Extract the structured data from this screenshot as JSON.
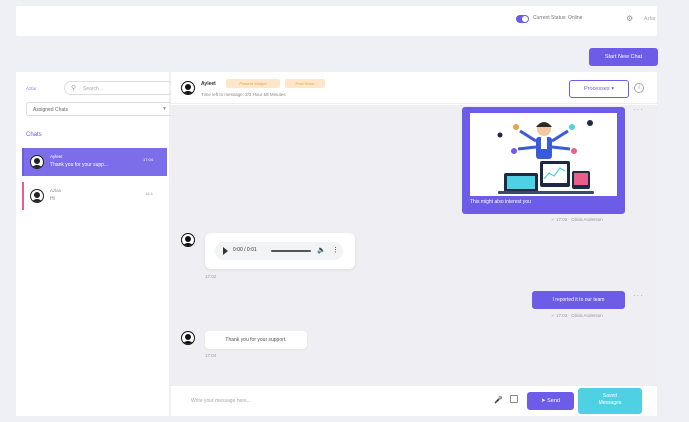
{
  "topbar": {
    "status_label": "Current Status: Online",
    "user_name": "Azfar"
  },
  "actions": {
    "start_new_chat": "Start New Chat"
  },
  "sidebar": {
    "filter_label": "Azfar",
    "search_placeholder": "Search...",
    "assigned_select": "Assigned Chats",
    "chats_heading": "Chats",
    "chats": [
      {
        "name": "Ayleet",
        "preview": "Thank you for your supp...",
        "time": "17:04",
        "active": true
      },
      {
        "name": "Azlan",
        "preview": "Hi",
        "time": "16:1",
        "active": false
      }
    ]
  },
  "conversation": {
    "contact_name": "Ayleet",
    "badges": [
      "Present Widget",
      "Pool Sessi"
    ],
    "subtitle": "Time left to message: 2/3 Hour 58 Minutes",
    "process_button": "Processes",
    "messages": [
      {
        "type": "image",
        "direction": "out",
        "caption": "This might also interest you",
        "meta": "17:02 · Olivia Anderson"
      },
      {
        "type": "audio",
        "direction": "in",
        "time_display": "0:00 / 0:01",
        "meta": "17:02"
      },
      {
        "type": "text",
        "direction": "out",
        "text": "I reported it to our team",
        "meta": "17:03 · Olivia Anderson"
      },
      {
        "type": "text",
        "direction": "in",
        "text": "Thank you for your support.",
        "meta": "17:04"
      }
    ]
  },
  "composer": {
    "placeholder": "Write your message here...",
    "send_label": "Send",
    "saved_label_line1": "Saved",
    "saved_label_line2": "Messages"
  },
  "colors": {
    "primary": "#6c5ce7",
    "badge_bg": "#fde7c8",
    "badge_text": "#e8a34a",
    "accent_cyan": "#4fd1e4",
    "unread_marker": "#e8608a"
  }
}
